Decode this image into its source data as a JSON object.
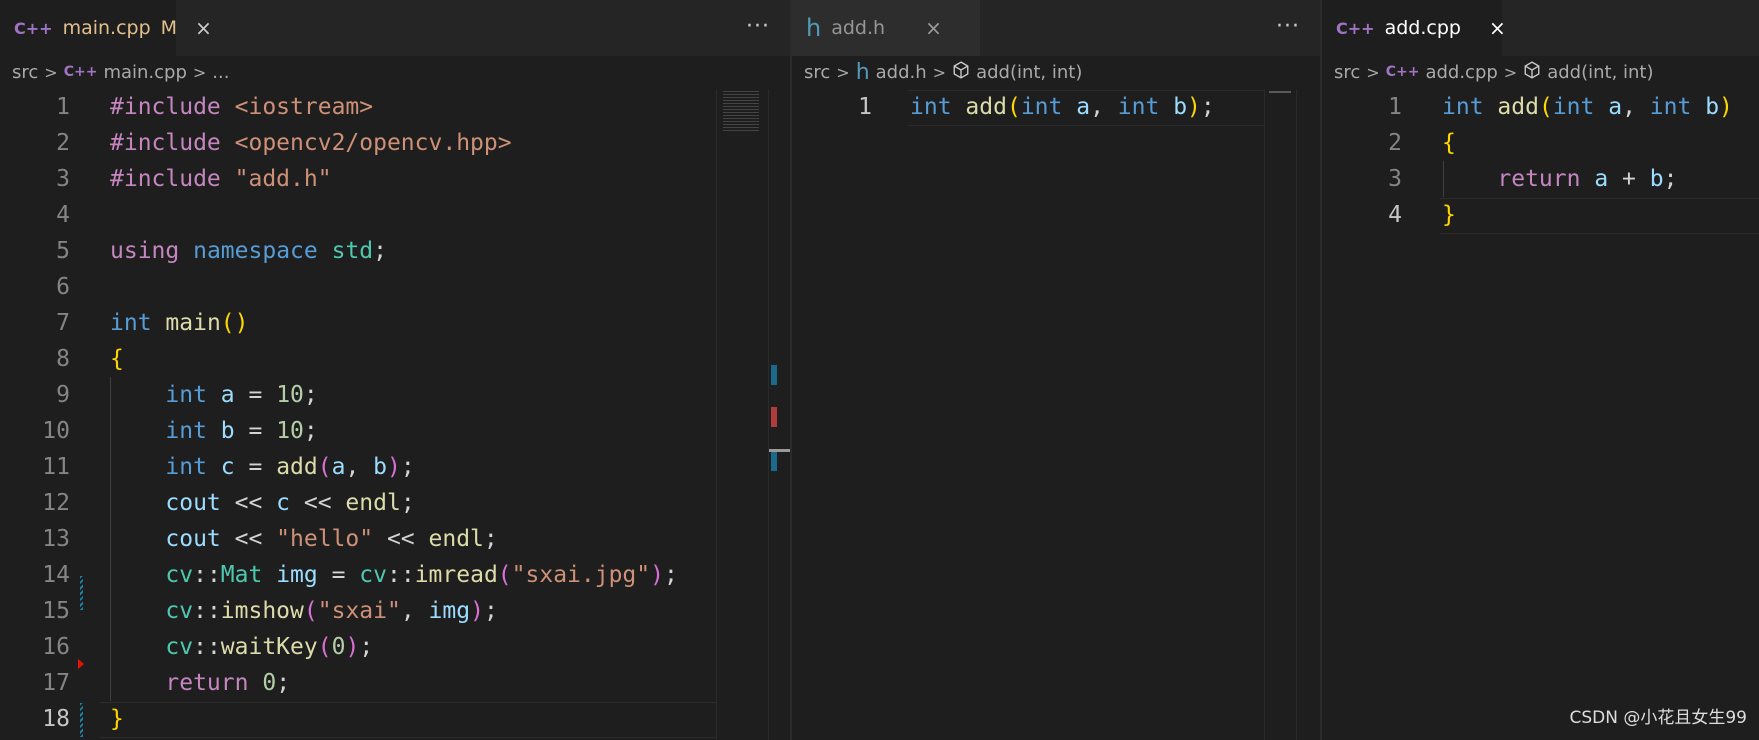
{
  "left_editor": {
    "tab": {
      "icon": "cpp-file-icon",
      "icon_glyph": "C++",
      "title": "main.cpp",
      "status": "M",
      "close": "×"
    },
    "more": "···",
    "breadcrumb": {
      "folder": "src",
      "file": "main.cpp",
      "rest": "..."
    },
    "line_numbers": [
      "1",
      "2",
      "3",
      "4",
      "5",
      "6",
      "7",
      "8",
      "9",
      "10",
      "11",
      "12",
      "13",
      "14",
      "15",
      "16",
      "17",
      "18"
    ]
  },
  "middle_editor": {
    "tab": {
      "icon": "header-file-icon",
      "icon_glyph": "h",
      "title": "add.h",
      "close": "×"
    },
    "more": "···",
    "breadcrumb": {
      "folder": "src",
      "file": "add.h",
      "symbol": "add(int, int)"
    },
    "line_numbers": [
      "1"
    ]
  },
  "right_editor": {
    "tab": {
      "icon": "cpp-file-icon",
      "icon_glyph": "C++",
      "title": "add.cpp",
      "close": "×"
    },
    "breadcrumb": {
      "folder": "src",
      "file": "add.cpp",
      "symbol": "add(int, int)"
    },
    "line_numbers": [
      "1",
      "2",
      "3",
      "4"
    ]
  },
  "separator_glyph": ">",
  "watermark": "CSDN @小花且女生99",
  "colors": {
    "background": "#1e1e1e",
    "keyword": "#569cd6",
    "control": "#c586c0",
    "function": "#dcdcaa",
    "variable": "#9cdcfe",
    "string": "#ce9178",
    "number": "#b5cea8",
    "type": "#4ec9b0"
  }
}
